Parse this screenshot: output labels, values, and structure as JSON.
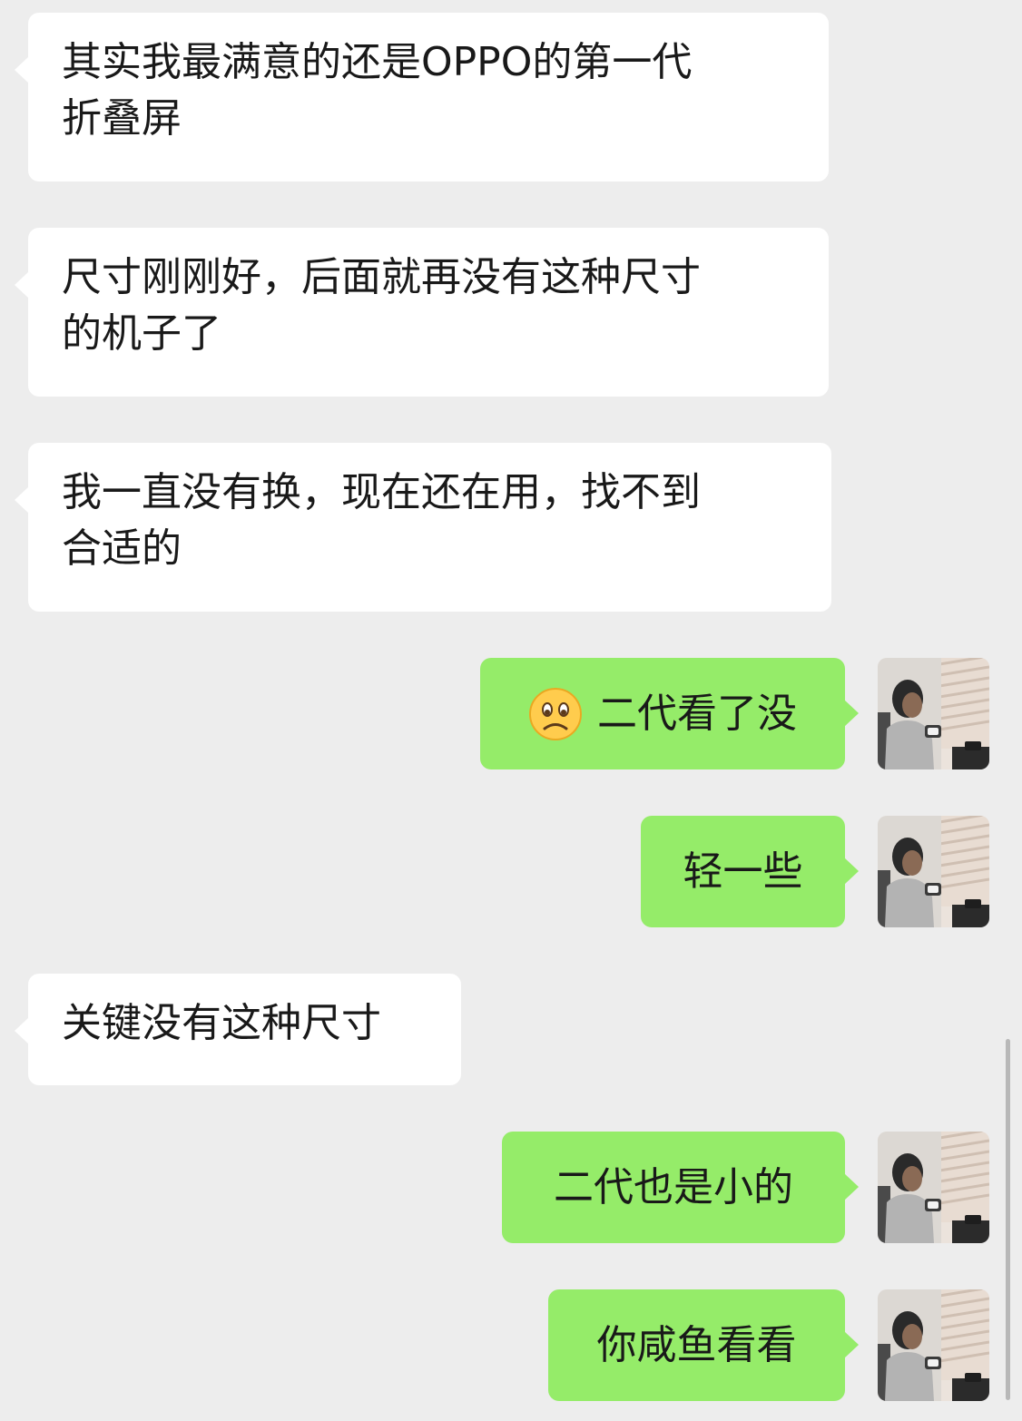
{
  "chat": {
    "messages": [
      {
        "side": "incoming",
        "lines": [
          "其实我最满意的还是OPPO的第一代",
          "折叠屏"
        ]
      },
      {
        "side": "incoming",
        "lines": [
          "尺寸刚刚好，后面就再没有这种尺寸",
          "的机子了"
        ]
      },
      {
        "side": "incoming",
        "lines": [
          "我一直没有换，现在还在用，找不到",
          "合适的"
        ]
      },
      {
        "side": "outgoing",
        "emoji": "frowning-face-emoji",
        "text": "二代看了没"
      },
      {
        "side": "outgoing",
        "text": "轻一些"
      },
      {
        "side": "incoming",
        "lines": [
          "关键没有这种尺寸"
        ]
      },
      {
        "side": "outgoing",
        "text": "二代也是小的"
      },
      {
        "side": "outgoing",
        "text": "你咸鱼看看"
      }
    ]
  },
  "colors": {
    "background": "#ededed",
    "incoming_bubble": "#ffffff",
    "outgoing_bubble": "#95ec69",
    "text": "#191919"
  }
}
